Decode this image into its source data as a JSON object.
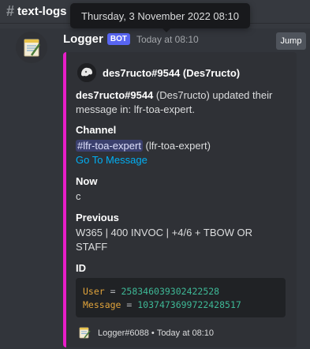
{
  "channel": {
    "name": "text-logs"
  },
  "tooltip": {
    "text": "Thursday, 3 November 2022 08:10"
  },
  "message": {
    "username": "Logger",
    "bot_tag": "BOT",
    "timestamp": "Today at 08:10",
    "jump_label": "Jump"
  },
  "embed": {
    "accent_color": "#e91ec8",
    "author": "des7ructo#9544 (Des7ructo)",
    "description": {
      "user_bold": "des7ructo#9544",
      "user_plain": " (Des7ructo) updated their message in: lfr-toa-expert."
    },
    "fields": {
      "channel": {
        "name": "Channel",
        "mention": "lfr-toa-expert",
        "mention_suffix": " (lfr-toa-expert)",
        "link": "Go To Message"
      },
      "now": {
        "name": "Now",
        "value": "c"
      },
      "previous": {
        "name": "Previous",
        "value": "W365 | 400 INVOC | +4/6 + TBOW OR STAFF"
      },
      "id": {
        "name": "ID",
        "user_key": "User",
        "user_value": "258346039302422528",
        "message_key": "Message",
        "message_value": "1037473699722428517"
      }
    },
    "footer": {
      "name": "Logger#6088",
      "separator": " • ",
      "time": "Today at 08:10"
    }
  }
}
